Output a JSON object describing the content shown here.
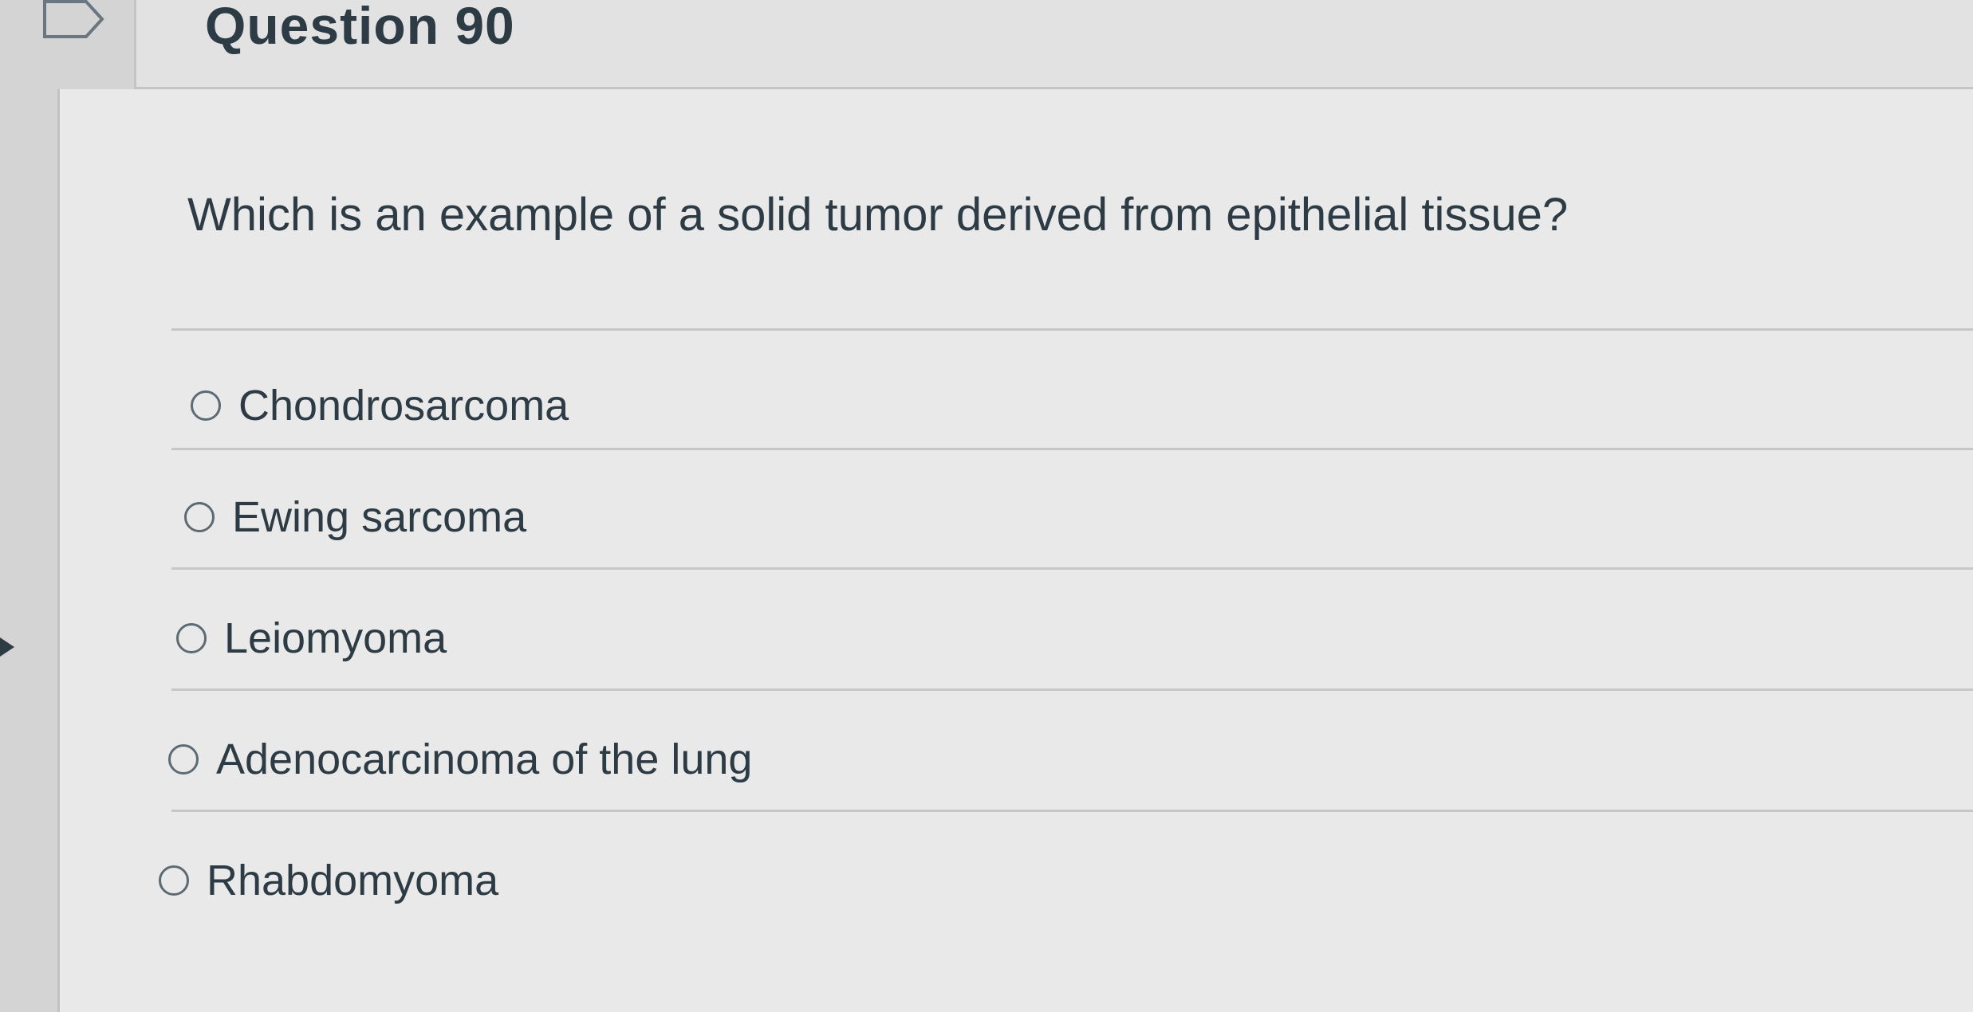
{
  "question": {
    "title": "Question 90",
    "prompt": "Which is an example of a solid tumor derived from epithelial tissue?",
    "answers": [
      {
        "label": "Chondrosarcoma"
      },
      {
        "label": "Ewing sarcoma"
      },
      {
        "label": "Leiomyoma"
      },
      {
        "label": "Adenocarcinoma of the lung"
      },
      {
        "label": "Rhabdomyoma"
      }
    ]
  },
  "icons": {
    "flag": "flag-icon",
    "nav": "arrow-left-icon",
    "radio": "radio-button-icon"
  },
  "colors": {
    "text": "#2d3b45",
    "background": "#e9e9e9",
    "divider": "#c6c6c6"
  }
}
